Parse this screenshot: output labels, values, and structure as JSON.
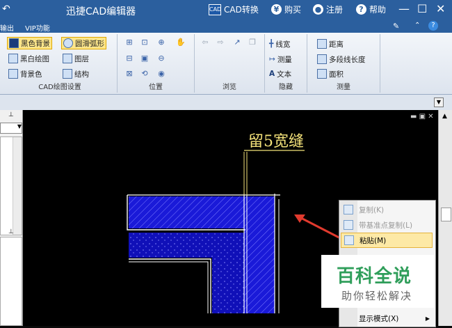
{
  "titlebar": {
    "back_glyph": "↶",
    "app_title": "迅捷CAD编辑器",
    "convert_label": "CAD转换",
    "buy_label": "购买",
    "register_label": "注册",
    "help_label": "帮助",
    "minimize": "—",
    "maximize": "☐",
    "close": "✕",
    "colors": {
      "bar": "#2b5f9e"
    }
  },
  "menubar": {
    "items": [
      "输出",
      "VIP功能"
    ]
  },
  "ribbon": {
    "cad_settings": {
      "label": "CAD绘图设置",
      "buttons": [
        "黑色背景",
        "圆滑弧形",
        "黑白绘图",
        "图层",
        "背景色",
        "结构"
      ]
    },
    "position": {
      "label": "位置"
    },
    "browse": {
      "label": "浏览"
    },
    "hide": {
      "label": "隐藏",
      "buttons": [
        "线宽",
        "测量",
        "文本"
      ]
    },
    "measure": {
      "label": "测量",
      "buttons": [
        "距离",
        "多段线长度",
        "面积"
      ]
    }
  },
  "drawing": {
    "annotation_text": "留5宽缝",
    "colors": {
      "hatch": "#1a1ad8",
      "annotation": "#f4e27a",
      "arrow": "#e03a2e"
    }
  },
  "context_menu": {
    "items": [
      {
        "label": "复制(K)",
        "state": "disabled"
      },
      {
        "label": "带基准点复制(L)",
        "state": "disabled"
      },
      {
        "label": "粘贴(M)",
        "state": "highlighted"
      },
      {
        "label": "显示模式(X)",
        "state": "submenu"
      }
    ]
  },
  "watermark": {
    "title": "百科全说",
    "subtitle": "助你轻松解决",
    "color": "#2f9e5a"
  }
}
